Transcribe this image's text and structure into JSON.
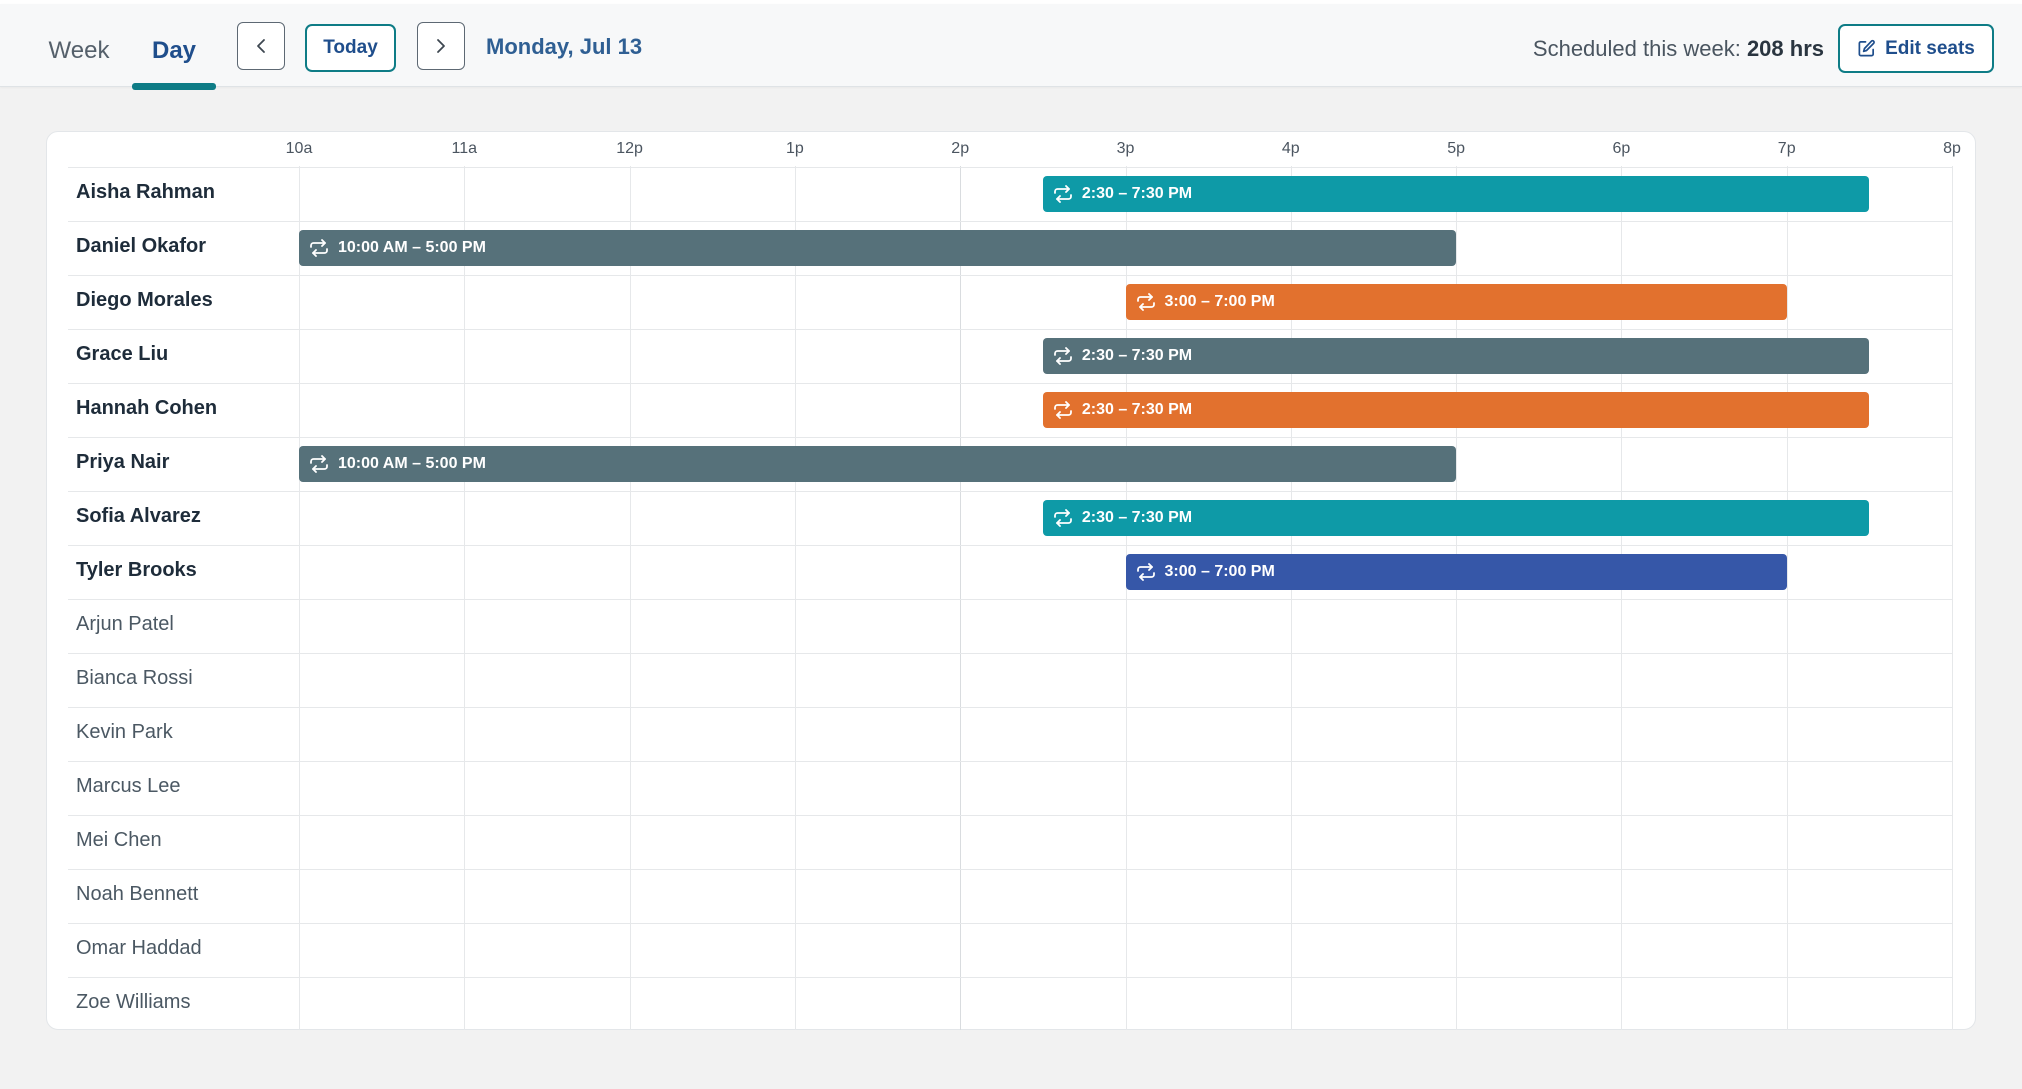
{
  "tabs": [
    {
      "label": "Week",
      "active": false
    },
    {
      "label": "Day",
      "active": true
    }
  ],
  "toolbar": {
    "prev_icon": "chevron-left-icon",
    "today_label": "Today",
    "next_icon": "chevron-right-icon",
    "date": "Monday, Jul 13",
    "scheduled_label": "Scheduled this week:",
    "scheduled_value": "208 hrs",
    "edit_icon": "edit-icon",
    "edit_label": "Edit seats"
  },
  "timeline": {
    "hours": [
      "10a",
      "11a",
      "12p",
      "1p",
      "2p",
      "3p",
      "4p",
      "5p",
      "6p",
      "7p",
      "8p"
    ]
  },
  "colors": {
    "teal": "#0e9aa7",
    "slate": "#56717a",
    "orange": "#e2712e",
    "blue": "#3657a8",
    "accent": "#0e7c86"
  },
  "staff": [
    {
      "name": "Aisha Rahman",
      "shift": {
        "label": "2:30 – 7:30 PM",
        "start": 14.5,
        "end": 19.5,
        "color": "teal"
      }
    },
    {
      "name": "Daniel Okafor",
      "shift": {
        "label": "10:00 AM – 5:00 PM",
        "start": 10,
        "end": 17,
        "color": "slate"
      }
    },
    {
      "name": "Diego Morales",
      "shift": {
        "label": "3:00 – 7:00 PM",
        "start": 15,
        "end": 19,
        "color": "orange"
      }
    },
    {
      "name": "Grace Liu",
      "shift": {
        "label": "2:30 – 7:30 PM",
        "start": 14.5,
        "end": 19.5,
        "color": "slate"
      }
    },
    {
      "name": "Hannah Cohen",
      "shift": {
        "label": "2:30 – 7:30 PM",
        "start": 14.5,
        "end": 19.5,
        "color": "orange"
      }
    },
    {
      "name": "Priya Nair",
      "shift": {
        "label": "10:00 AM – 5:00 PM",
        "start": 10,
        "end": 17,
        "color": "slate"
      }
    },
    {
      "name": "Sofia Alvarez",
      "shift": {
        "label": "2:30 – 7:30 PM",
        "start": 14.5,
        "end": 19.5,
        "color": "teal"
      }
    },
    {
      "name": "Tyler Brooks",
      "shift": {
        "label": "3:00 – 7:00 PM",
        "start": 15,
        "end": 19,
        "color": "blue"
      }
    },
    {
      "name": "Arjun Patel",
      "shift": null
    },
    {
      "name": "Bianca Rossi",
      "shift": null
    },
    {
      "name": "Kevin Park",
      "shift": null
    },
    {
      "name": "Marcus Lee",
      "shift": null
    },
    {
      "name": "Mei Chen",
      "shift": null
    },
    {
      "name": "Noah Bennett",
      "shift": null
    },
    {
      "name": "Omar Haddad",
      "shift": null
    },
    {
      "name": "Zoe Williams",
      "shift": null
    }
  ]
}
